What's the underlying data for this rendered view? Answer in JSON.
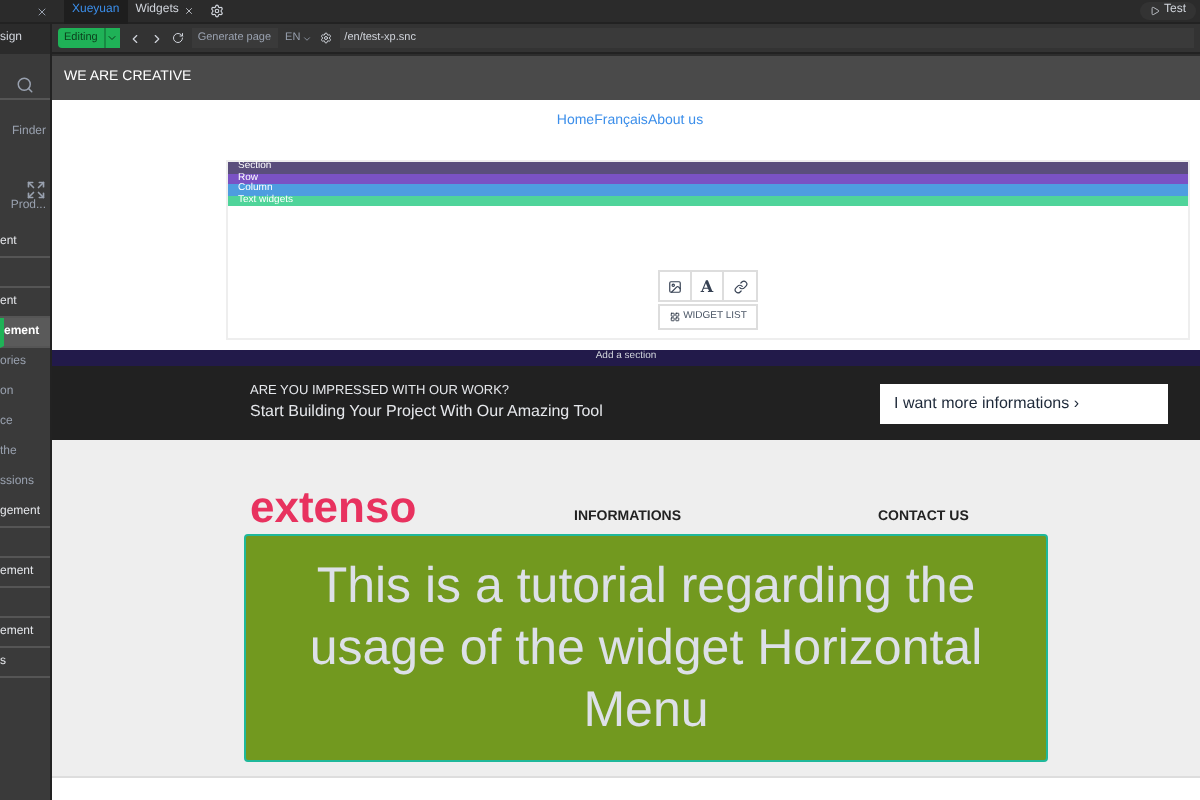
{
  "tabs": [
    {
      "label": "Xueyuan",
      "selected": true,
      "closable": false
    },
    {
      "label": "Widgets",
      "selected": false,
      "closable": true
    }
  ],
  "test_button": "Test",
  "sidebar": {
    "top_label": "sign",
    "items": [
      {
        "label": "Finder",
        "kind": "icon",
        "selected": false
      },
      {
        "label": "Prod...",
        "kind": "icon",
        "selected": false
      },
      {
        "label": "ent",
        "kind": "row",
        "selected": false
      },
      {
        "label": "ent",
        "kind": "row",
        "selected": false,
        "gap_before": true
      },
      {
        "label": "ement",
        "kind": "row",
        "selected": true
      },
      {
        "label": "ories",
        "kind": "sub",
        "selected": false
      },
      {
        "label": "on",
        "kind": "sub",
        "selected": false
      },
      {
        "label": "ce",
        "kind": "sub",
        "selected": false
      },
      {
        "label": "the",
        "kind": "sub",
        "selected": false
      },
      {
        "label": "ssions",
        "kind": "sub",
        "selected": false
      },
      {
        "label": "gement",
        "kind": "row",
        "selected": false
      },
      {
        "label": "ement",
        "kind": "row",
        "selected": false,
        "gap_before": true
      },
      {
        "label": "ement",
        "kind": "row",
        "selected": false,
        "gap_before": true
      },
      {
        "label": "s",
        "kind": "row",
        "selected": false
      }
    ]
  },
  "toolbar": {
    "mode": "Editing",
    "generate": "Generate page",
    "language": "EN",
    "path": "/en/test-xp.snc"
  },
  "page": {
    "header": "WE ARE CREATIVE",
    "menu": [
      "Home",
      "Français",
      "About us"
    ],
    "bands": [
      {
        "label": "Section",
        "color": "#5a4e7c"
      },
      {
        "label": "Row",
        "color": "#7a52c4"
      },
      {
        "label": "Column",
        "color": "#4e9de0"
      },
      {
        "label": "Text widgets",
        "color": "#4fd49a"
      }
    ],
    "widget_tools": {
      "text_tool": "A",
      "list": "WIDGET LIST"
    },
    "add_section": "Add a section",
    "cta": {
      "eyebrow": "ARE YOU IMPRESSED WITH OUR WORK?",
      "headline": "Start Building Your Project With Our Amazing Tool",
      "button": "I want more informations ›"
    },
    "footer": {
      "logo": "extenso",
      "columns": [
        "INFORMATIONS",
        "CONTACT US"
      ]
    }
  },
  "overlay": "This is a tutorial regarding the usage of the widget Horizontal Menu"
}
